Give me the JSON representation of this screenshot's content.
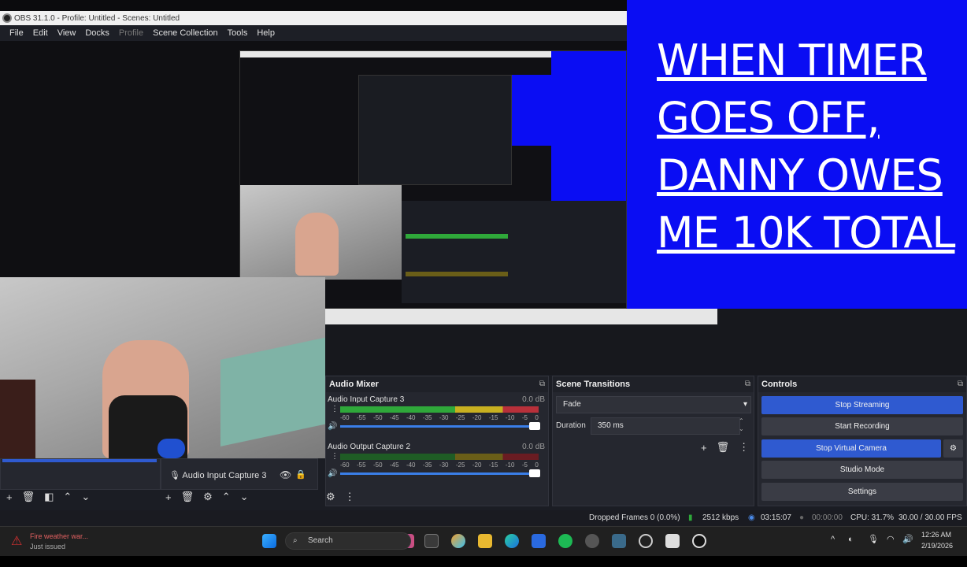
{
  "window": {
    "title": "OBS 31.1.0 - Profile: Untitled - Scenes: Untitled"
  },
  "menu": [
    {
      "label": "File",
      "enabled": true
    },
    {
      "label": "Edit",
      "enabled": true
    },
    {
      "label": "View",
      "enabled": true
    },
    {
      "label": "Docks",
      "enabled": true
    },
    {
      "label": "Profile",
      "enabled": false
    },
    {
      "label": "Scene Collection",
      "enabled": true
    },
    {
      "label": "Tools",
      "enabled": true
    },
    {
      "label": "Help",
      "enabled": true
    }
  ],
  "overlay": {
    "lines": [
      "WHEN TIMER",
      "GOES OFF,",
      "DANNY OWES",
      "ME 10K TOTAL"
    ],
    "color": "#0a0df3"
  },
  "sources": {
    "visible_item": "Audio Input Capture 3"
  },
  "audio_mixer": {
    "title": "Audio Mixer",
    "channels": [
      {
        "name": "Audio Input Capture 3",
        "db": "0.0 dB",
        "level": 0.6
      },
      {
        "name": "Audio Output Capture 2",
        "db": "0.0 dB",
        "level": 0.0
      }
    ],
    "ticks": [
      "-60",
      "-55",
      "-50",
      "-45",
      "-40",
      "-35",
      "-30",
      "-25",
      "-20",
      "-15",
      "-10",
      "-5",
      "0"
    ]
  },
  "scene_transitions": {
    "title": "Scene Transitions",
    "transition": "Fade",
    "duration_label": "Duration",
    "duration_value": "350 ms"
  },
  "controls": {
    "title": "Controls",
    "buttons": {
      "stop_streaming": "Stop Streaming",
      "start_recording": "Start Recording",
      "stop_virtual_camera": "Stop Virtual Camera",
      "studio_mode": "Studio Mode",
      "settings": "Settings"
    }
  },
  "status": {
    "dropped_frames": "Dropped Frames 0 (0.0%)",
    "bitrate": "2512 kbps",
    "stream_time": "03:15:07",
    "record_time": "00:00:00",
    "cpu": "CPU: 31.7%",
    "fps": "30.00 / 30.00 FPS"
  },
  "taskbar": {
    "notification_title": "Fire weather war...",
    "notification_sub": "Just issued",
    "search_placeholder": "Search",
    "time": "12:26 AM",
    "date": "2/19/2026"
  }
}
